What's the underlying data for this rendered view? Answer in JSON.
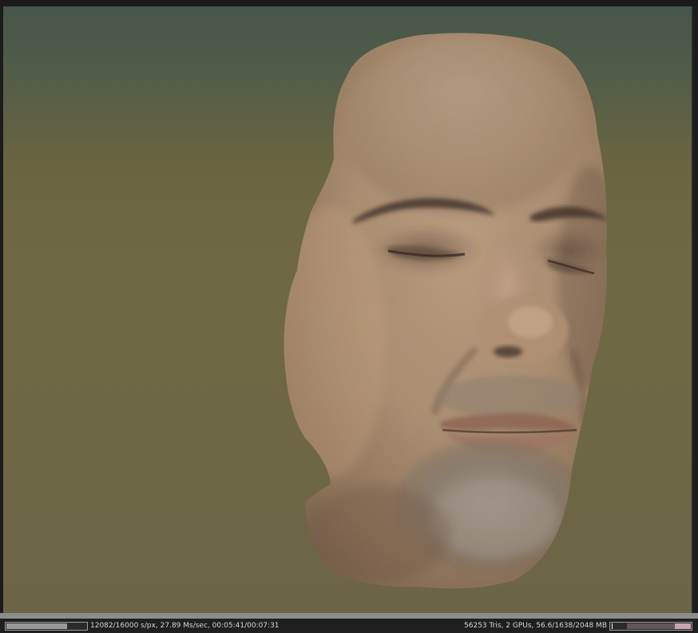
{
  "viewport": {
    "render_subject": "face-3d-scan"
  },
  "status_bar": {
    "render_progress": 0.755,
    "render_stats": "12082/16000 s/px, 27.89 Ms/sec, 00:05:41/00:07:31",
    "scene_stats": "56253 Tris, 2 GPUs, 56.6/1638/2048 MB",
    "memory_usage": 0.8
  },
  "colors": {
    "background_top": "#46564b",
    "background_bottom": "#6b6546",
    "skin": "#a88a6c",
    "status_text": "#d6d6d6"
  }
}
